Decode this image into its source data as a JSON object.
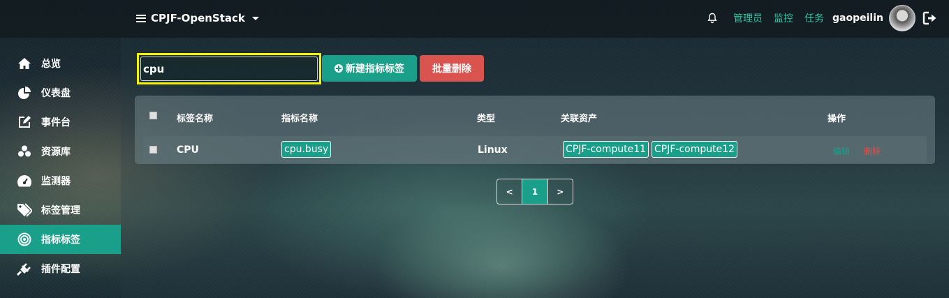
{
  "header": {
    "project": "CPJF-OpenStack",
    "links": [
      "管理员",
      "监控",
      "任务"
    ],
    "username": "gaopeilin"
  },
  "sidebar": {
    "items": [
      {
        "label": "总览",
        "icon": "home-icon"
      },
      {
        "label": "仪表盘",
        "icon": "pie-chart-icon"
      },
      {
        "label": "事件台",
        "icon": "edit-icon"
      },
      {
        "label": "资源库",
        "icon": "cubes-icon"
      },
      {
        "label": "监测器",
        "icon": "dashboard-icon"
      },
      {
        "label": "标签管理",
        "icon": "tags-icon"
      },
      {
        "label": "指标标签",
        "icon": "bullseye-icon",
        "active": true
      },
      {
        "label": "插件配置",
        "icon": "plug-icon"
      }
    ]
  },
  "toolbar": {
    "search_value": "cpu",
    "new_label": "新建指标标签",
    "delete_label": "批量删除"
  },
  "table": {
    "headers": [
      "标签名称",
      "指标名称",
      "类型",
      "关联资产",
      "操作"
    ],
    "rows": [
      {
        "tag_name": "CPU",
        "metric": "cpu.busy",
        "type": "Linux",
        "assets": [
          "CPJF-compute11",
          "CPJF-compute12"
        ],
        "edit": "编辑",
        "delete": "删除"
      }
    ]
  },
  "pagination": {
    "prev": "<",
    "current": "1",
    "next": ">"
  },
  "colors": {
    "accent": "#1aa08a",
    "danger": "#d9534f",
    "highlight": "#f2f20a",
    "link": "#33c4a7"
  }
}
